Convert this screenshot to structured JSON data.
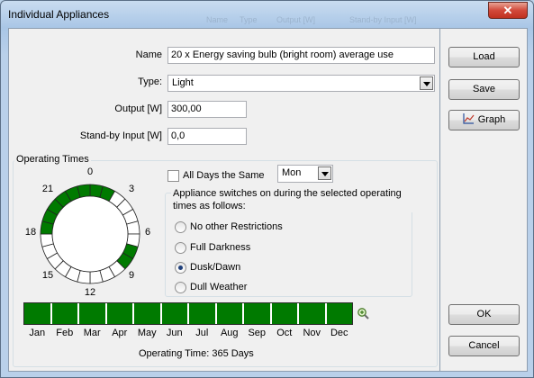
{
  "window": {
    "title": "Individual Appliances",
    "close_glyph": "✕",
    "ghost_texts": [
      "Name",
      "Type",
      "Output [W]",
      "Stand-by Input [W]"
    ]
  },
  "fields": {
    "name_label": "Name",
    "name_value": "20 x Energy saving bulb (bright room) average use",
    "type_label": "Type:",
    "type_value": "Light",
    "output_label": "Output [W]",
    "output_value": "300,00",
    "standby_label": "Stand-by Input [W]",
    "standby_value": "0,0"
  },
  "operating_times": {
    "group_title": "Operating Times",
    "all_days_label": "All Days the Same",
    "all_days_checked": false,
    "day_value": "Mon",
    "switch_group_title": "Appliance switches on during the selected operating times as follows:",
    "options": [
      "No other Restrictions",
      "Full Darkness",
      "Dusk/Dawn",
      "Dull Weather"
    ],
    "selected_option": 2,
    "hour_labels": [
      "0",
      "3",
      "6",
      "9",
      "12",
      "15",
      "18",
      "21"
    ],
    "active_hours": [
      0,
      1,
      7,
      8,
      18,
      19,
      20,
      21,
      22,
      23
    ],
    "months": [
      "Jan",
      "Feb",
      "Mar",
      "Apr",
      "May",
      "Jun",
      "Jul",
      "Aug",
      "Sep",
      "Oct",
      "Nov",
      "Dec"
    ],
    "active_months": [
      1,
      1,
      1,
      1,
      1,
      1,
      1,
      1,
      1,
      1,
      1,
      1
    ],
    "footer_label": "Operating Time:",
    "footer_value": "365 Days"
  },
  "buttons": {
    "load": "Load",
    "save": "Save",
    "graph": "Graph",
    "ok": "OK",
    "cancel": "Cancel"
  },
  "colors": {
    "active_green": "#007a00",
    "inactive": "#ffffff",
    "ring_stroke": "#222222"
  },
  "icons": {
    "close": "close-icon",
    "graph": "graph-icon",
    "zoom": "magnifier-icon",
    "dropdown": "chevron-down-icon"
  }
}
